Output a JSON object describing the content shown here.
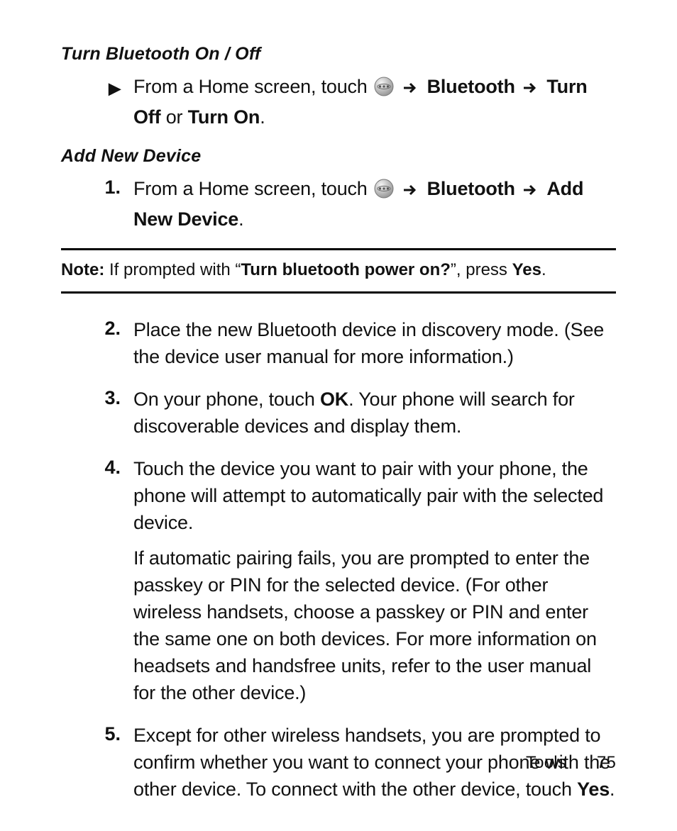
{
  "section1": {
    "heading": "Turn Bluetooth On / Off",
    "step": {
      "pre": "From a Home screen, touch ",
      "bt": "Bluetooth",
      "turnoff": "Turn Off",
      "or": " or ",
      "turnon": "Turn On",
      "period": "."
    }
  },
  "section2": {
    "heading": "Add New Device",
    "step1": {
      "num": "1.",
      "pre": "From a Home screen, touch ",
      "bt": "Bluetooth",
      "addnew": "Add New Device",
      "period": "."
    },
    "note": {
      "label": "Note:",
      "pre": " If prompted with “",
      "prompt": "Turn bluetooth power on?",
      "post": "”, press ",
      "yes": "Yes",
      "period": "."
    },
    "step2": {
      "num": "2.",
      "text": "Place the new Bluetooth device in discovery mode. (See the device user manual for more information.)"
    },
    "step3": {
      "num": "3.",
      "pre": "On your phone, touch ",
      "ok": "OK",
      "post": ". Your phone will search for discoverable devices and display them."
    },
    "step4": {
      "num": "4.",
      "p1": "Touch the device you want to pair with your phone, the phone will attempt to automatically pair with the selected device.",
      "p2": "If automatic pairing fails, you are prompted to enter the passkey or PIN for the selected device. (For other wireless handsets, choose a passkey or PIN and enter the same one on both devices. For more information on headsets and handsfree units, refer to the user manual for the other device.)"
    },
    "step5": {
      "num": "5.",
      "pre": "Except for other wireless handsets, you are prompted to confirm whether you want to connect your phone with the other device. To connect with the other device, touch ",
      "yes": "Yes",
      "period": "."
    }
  },
  "footer": {
    "section": "Tools",
    "page": "75"
  }
}
